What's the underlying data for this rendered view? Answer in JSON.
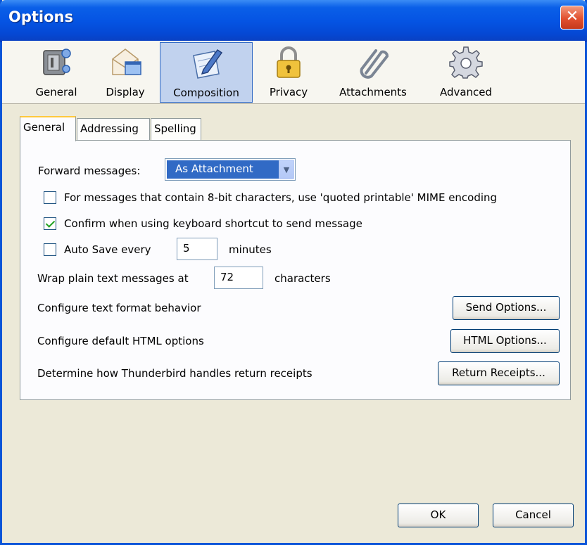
{
  "window": {
    "title": "Options",
    "close_label": "✕"
  },
  "panes": [
    {
      "label": "General",
      "icon": "general-icon"
    },
    {
      "label": "Display",
      "icon": "display-icon"
    },
    {
      "label": "Composition",
      "icon": "composition-icon",
      "selected": true
    },
    {
      "label": "Privacy",
      "icon": "lock-icon"
    },
    {
      "label": "Attachments",
      "icon": "paperclip-icon"
    },
    {
      "label": "Advanced",
      "icon": "gear-icon"
    }
  ],
  "tabs": [
    {
      "label": "General",
      "active": true
    },
    {
      "label": "Addressing"
    },
    {
      "label": "Spelling"
    }
  ],
  "general": {
    "forward_label": "Forward messages:",
    "forward_value": "As Attachment",
    "quoted_printable_label": "For messages that contain 8-bit characters, use 'quoted printable' MIME encoding",
    "quoted_printable_checked": false,
    "confirm_shortcut_label": "Confirm when using keyboard shortcut to send message",
    "confirm_shortcut_checked": true,
    "autosave_label": "Auto Save every",
    "autosave_value": "5",
    "autosave_unit": "minutes",
    "autosave_checked": false,
    "wrap_label": "Wrap plain text messages at",
    "wrap_value": "72",
    "wrap_unit": "characters",
    "text_format_label": "Configure text format behavior",
    "send_options_button": "Send Options...",
    "html_label": "Configure default HTML options",
    "html_options_button": "HTML Options...",
    "receipts_label": "Determine how Thunderbird handles return receipts",
    "receipts_button": "Return Receipts..."
  },
  "footer": {
    "ok_label": "OK",
    "cancel_label": "Cancel"
  },
  "colors": {
    "titlebar": "#0554e3",
    "selection": "#316ac5",
    "window_bg": "#ece9d8"
  }
}
